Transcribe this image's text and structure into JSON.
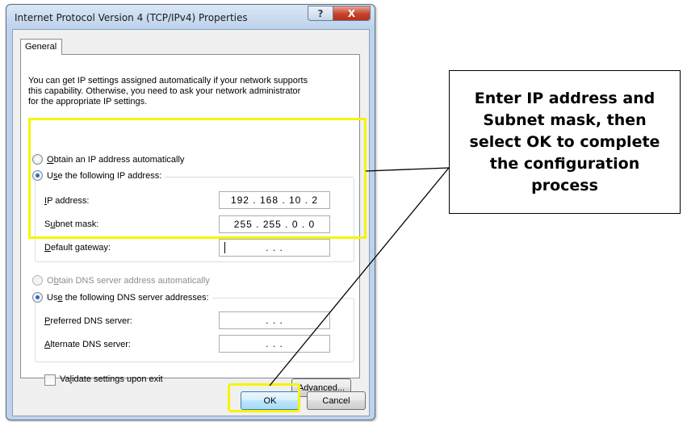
{
  "window": {
    "title": "Internet Protocol Version 4 (TCP/IPv4) Properties",
    "help_label": "?",
    "close_label": "X"
  },
  "tabs": [
    {
      "label": "General"
    }
  ],
  "intro": {
    "line1": "You can get IP settings assigned automatically if your network supports",
    "line2": "this capability. Otherwise, you need to ask your network administrator",
    "line3": "for the appropriate IP settings."
  },
  "ip_section": {
    "obtain_auto": {
      "key": "O",
      "rest": "btain an IP address automatically",
      "selected": false
    },
    "use_following": {
      "pre": "U",
      "key": "s",
      "rest": "e the following IP address:",
      "selected": true
    },
    "fields": [
      {
        "key": "I",
        "rest": "P address:",
        "value": "192 . 168 . 10 . 2"
      },
      {
        "pre": "S",
        "key": "u",
        "rest": "bnet mask:",
        "value": "255 . 255 . 0 . 0"
      },
      {
        "key": "D",
        "rest": "efault gateway:",
        "value": ".   .   ."
      }
    ]
  },
  "dns_section": {
    "obtain_auto": {
      "pre": "O",
      "key": "b",
      "rest": "tain DNS server address automatically",
      "selected": false,
      "disabled": true
    },
    "use_following": {
      "pre": "Us",
      "key": "e",
      "rest": " the following DNS server addresses:",
      "selected": true
    },
    "fields": [
      {
        "key": "P",
        "rest": "referred DNS server:",
        "value": ".   .   ."
      },
      {
        "key": "A",
        "rest": "lternate DNS server:",
        "value": ".   .   ."
      }
    ]
  },
  "validate": {
    "pre": "Va",
    "key": "l",
    "rest": "idate settings upon exit",
    "checked": false
  },
  "buttons": {
    "advanced": {
      "pre": "Ad",
      "key": "v",
      "rest": "anced..."
    },
    "ok": "OK",
    "cancel": "Cancel"
  },
  "callout": {
    "text": "Enter IP address and Subnet mask, then select OK to complete the configuration process"
  },
  "colors": {
    "highlight": "#f5f500",
    "accent": "#2a6cc0"
  }
}
